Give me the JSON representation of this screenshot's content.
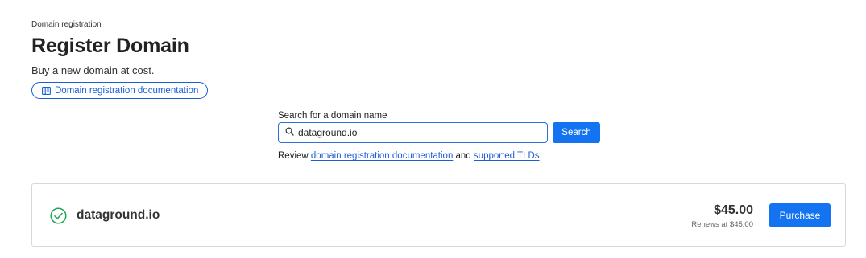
{
  "header": {
    "breadcrumb": "Domain registration",
    "title": "Register Domain",
    "subtitle": "Buy a new domain at cost.",
    "doc_link": {
      "label": "Domain registration documentation",
      "icon": "book-icon"
    }
  },
  "search": {
    "label": "Search for a domain name",
    "value": "dataground.io",
    "icon": "search-icon",
    "button_label": "Search"
  },
  "help": {
    "prefix": "Review ",
    "link1": "domain registration documentation",
    "middle": " and ",
    "link2": "supported TLDs",
    "suffix": "."
  },
  "result": {
    "status_icon": "check-circle-icon",
    "domain": "dataground.io",
    "price": "$45.00",
    "renewal": "Renews at $45.00",
    "button_label": "Purchase"
  },
  "colors": {
    "accent": "#1473f0",
    "link": "#1a5fd6",
    "success": "#22a455"
  }
}
